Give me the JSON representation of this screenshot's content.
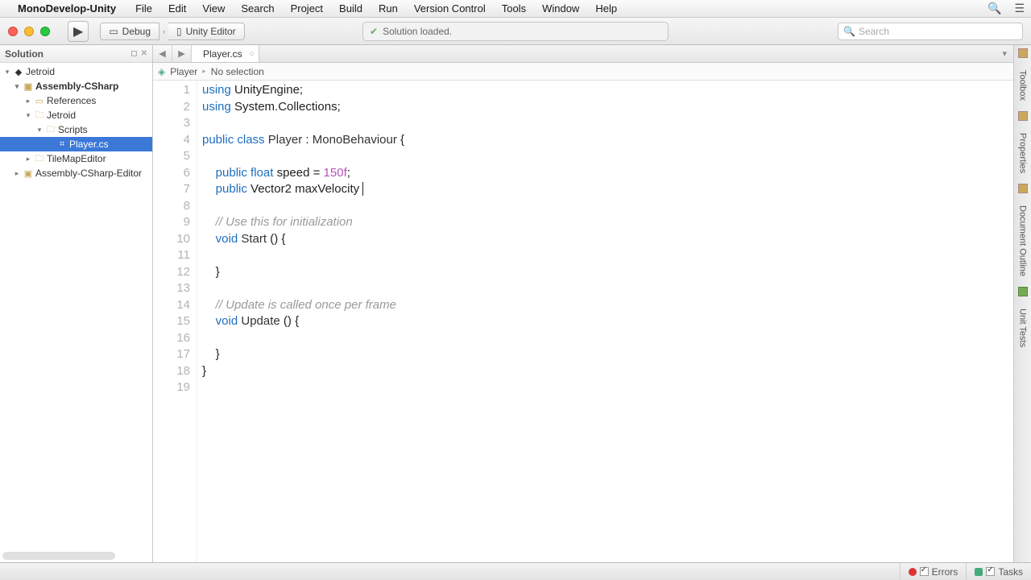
{
  "menubar": {
    "app": "MonoDevelop-Unity",
    "items": [
      "File",
      "Edit",
      "View",
      "Search",
      "Project",
      "Build",
      "Run",
      "Version Control",
      "Tools",
      "Window",
      "Help"
    ]
  },
  "toolbar": {
    "run_glyph": "▶",
    "config_debug": "Debug",
    "config_target": "Unity Editor",
    "status_text": "Solution loaded.",
    "search_placeholder": "Search"
  },
  "solution": {
    "title": "Solution",
    "nodes": {
      "root": "Jetroid",
      "asm": "Assembly-CSharp",
      "refs": "References",
      "jetroid_folder": "Jetroid",
      "scripts_folder": "Scripts",
      "player_file": "Player.cs",
      "tilemap": "TileMapEditor",
      "asm_editor": "Assembly-CSharp-Editor"
    }
  },
  "tabs": {
    "file": "Player.cs"
  },
  "breadcrumb": {
    "class": "Player",
    "member": "No selection"
  },
  "code": {
    "l1a": "using",
    "l1b": " UnityEngine;",
    "l2a": "using",
    "l2b": " System.Collections;",
    "l4a": "public",
    "l4b": "class",
    "l4c": "Player",
    "l4d": "MonoBehaviour",
    "l6a": "public",
    "l6b": "float",
    "l6c": " speed = ",
    "l6d": "150f",
    "l6e": ";",
    "l7a": "public",
    "l7b": " Vector2 maxVelocity ",
    "l9": "// Use this for initialization",
    "l10a": "void",
    "l10b": "Start",
    "l14": "// Update is called once per frame",
    "l15a": "void",
    "l15b": "Update"
  },
  "dock": {
    "toolbox": "Toolbox",
    "properties": "Properties",
    "outline": "Document Outline",
    "tests": "Unit Tests"
  },
  "statusbar": {
    "errors": "Errors",
    "tasks": "Tasks"
  }
}
